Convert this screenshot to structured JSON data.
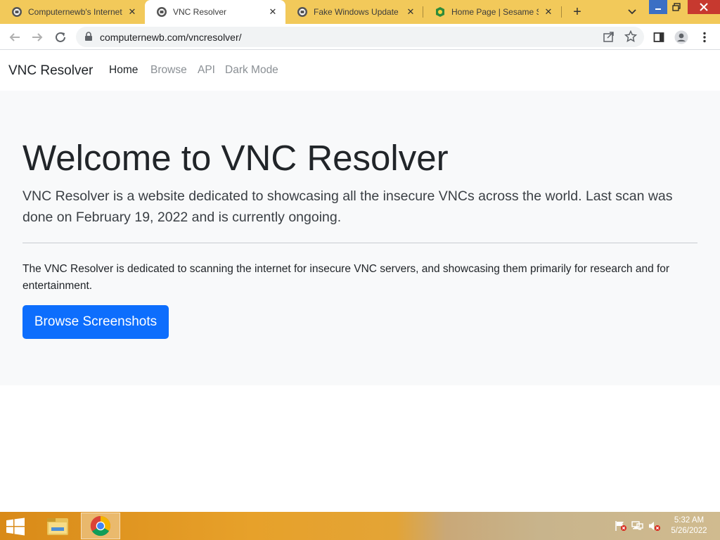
{
  "browser": {
    "tabs": [
      {
        "title": "Computernewb's Internet",
        "icon": "computernewb-favicon",
        "active": false
      },
      {
        "title": "VNC Resolver",
        "icon": "computernewb-favicon",
        "active": true
      },
      {
        "title": "Fake Windows Update Pr",
        "icon": "computernewb-favicon",
        "active": false
      },
      {
        "title": "Home Page | Sesame Stre",
        "icon": "sesame-street-favicon",
        "active": false
      }
    ],
    "url": "computernewb.com/vncresolver/"
  },
  "navbar": {
    "brand": "VNC Resolver",
    "links": [
      "Home",
      "Browse",
      "API",
      "Dark Mode"
    ]
  },
  "hero": {
    "title": "Welcome to VNC Resolver",
    "lead": "VNC Resolver is a website dedicated to showcasing all the insecure VNCs across the world. Last scan was done on February 19, 2022 and is currently ongoing.",
    "description": "The VNC Resolver is dedicated to scanning the internet for insecure VNC servers, and showcasing them primarily for research and for entertainment.",
    "button": "Browse Screenshots"
  },
  "taskbar": {
    "time": "5:32 AM",
    "date": "5/26/2022"
  },
  "colors": {
    "tabstrip": "#f2c95a",
    "primary_button": "#0d6efd",
    "jumbotron_bg": "#f8f9fa"
  }
}
